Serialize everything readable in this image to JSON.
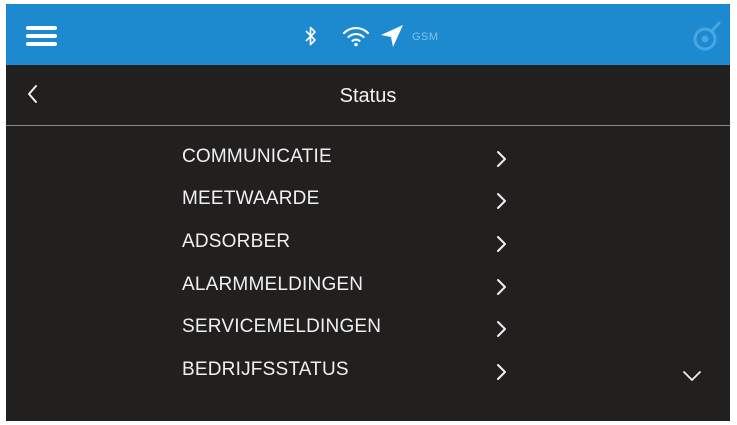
{
  "topbar": {
    "background": "#1d8ad0",
    "icons": [
      "hamburger-menu-icon",
      "bluetooth-icon",
      "wifi-icon",
      "location-arrow-icon",
      "brand-logo-icon"
    ],
    "gsm_label": "GSM"
  },
  "header": {
    "title": "Status"
  },
  "menu": {
    "items": [
      {
        "label": "COMMUNICATIE"
      },
      {
        "label": "MEETWAARDE"
      },
      {
        "label": "ADSORBER"
      },
      {
        "label": "ALARMMELDINGEN"
      },
      {
        "label": "SERVICEMELDINGEN"
      },
      {
        "label": "BEDRIJFSSTATUS"
      }
    ]
  },
  "colors": {
    "screen_background": "#221f1f",
    "text": "#f0f0f0",
    "accent": "#1d8ad0"
  }
}
